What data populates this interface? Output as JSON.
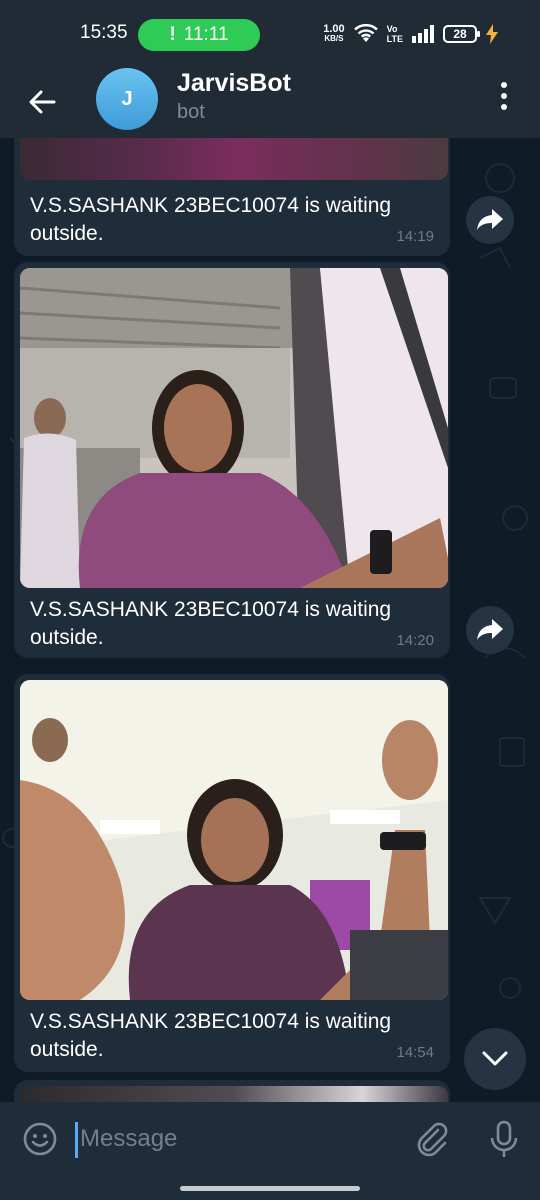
{
  "status_bar": {
    "time": "15:35",
    "call_timer": "11:11",
    "net_speed_value": "1.00",
    "net_speed_unit": "KB/S",
    "volte_top": "Vo",
    "volte_bottom": "LTE",
    "battery": "28"
  },
  "header": {
    "avatar_letter": "J",
    "title": "JarvisBot",
    "subtitle": "bot"
  },
  "messages": [
    {
      "text": "V.S.SASHANK 23BEC10074 is waiting outside.",
      "time": "14:19"
    },
    {
      "text": "V.S.SASHANK 23BEC10074 is waiting outside.",
      "time": "14:20"
    },
    {
      "text": "V.S.SASHANK 23BEC10074 is waiting outside.",
      "time": "14:54"
    }
  ],
  "input": {
    "placeholder": "Message"
  },
  "colors": {
    "accent": "#5aaaf3",
    "call_pill": "#2ecb57",
    "bubble": "#1f2c39",
    "background": "#0f1c28"
  },
  "icons": [
    "back-arrow-icon",
    "more-vert-icon",
    "forward-icon",
    "chevron-down-icon",
    "emoji-icon",
    "paperclip-icon",
    "mic-icon",
    "wifi-icon",
    "signal-icon",
    "battery-icon",
    "charging-icon"
  ]
}
